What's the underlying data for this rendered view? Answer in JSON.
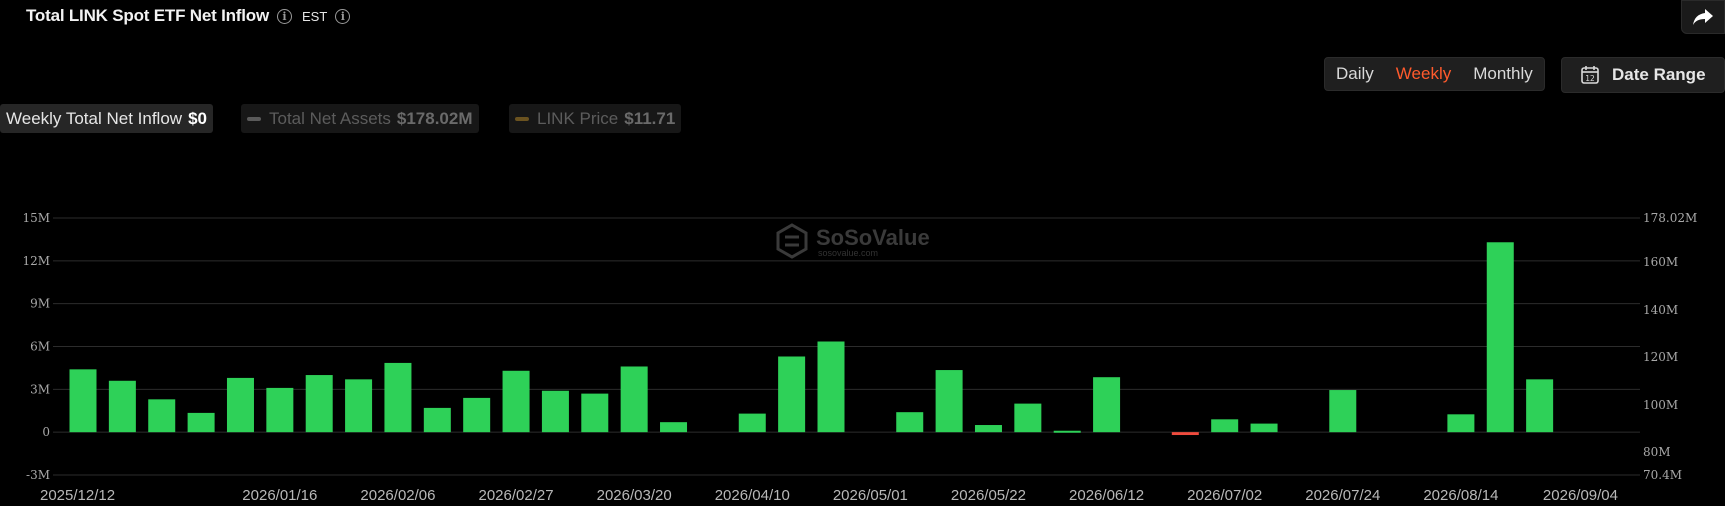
{
  "header": {
    "title": "Total LINK Spot ETF Net Inflow",
    "timezone": "EST"
  },
  "controls": {
    "periods": [
      "Daily",
      "Weekly",
      "Monthly"
    ],
    "active_period": "Weekly",
    "date_range_label": "Date Range",
    "date_range_icon_digit": "12"
  },
  "legend": {
    "net_inflow": {
      "label": "Weekly Total Net Inflow",
      "value": "$0"
    },
    "net_assets": {
      "label": "Total Net Assets",
      "value": "$178.02M"
    },
    "link_price": {
      "label": "LINK Price",
      "value": "$11.71"
    }
  },
  "watermark": {
    "brand": "SoSoValue",
    "sub": "sosovalue.com"
  },
  "colors": {
    "positive": "#2ed158",
    "negative": "#f04b3e",
    "active_tab": "#ff5a2c",
    "net_assets_line": "#5a5a5a",
    "price_line": "#6b5320"
  },
  "chart_data": {
    "type": "bar",
    "series": [
      {
        "name": "Weekly Total Net Inflow"
      }
    ],
    "x": [
      "2025/12/12",
      "2025/12/19",
      "2025/12/26",
      "2026/01/02",
      "2026/01/09",
      "2026/01/16",
      "2026/01/23",
      "2026/01/30",
      "2026/02/06",
      "2026/02/13",
      "2026/02/20",
      "2026/02/27",
      "2026/03/06",
      "2026/03/13",
      "2026/03/20",
      "2026/03/27",
      "2026/04/03",
      "2026/04/10",
      "2026/04/17",
      "2026/04/24",
      "2026/05/01",
      "2026/05/08",
      "2026/05/15",
      "2026/05/22",
      "2026/05/29",
      "2026/06/05",
      "2026/06/12",
      "2026/06/19",
      "2026/06/26",
      "2026/07/02",
      "2026/07/10",
      "2026/07/17",
      "2026/07/24",
      "2026/07/31",
      "2026/08/07",
      "2026/08/14",
      "2026/08/21",
      "2026/08/28",
      "2026/09/04"
    ],
    "values": [
      4.4,
      3.6,
      2.3,
      1.35,
      3.8,
      3.1,
      4.0,
      3.7,
      4.85,
      1.7,
      2.4,
      4.3,
      2.9,
      2.7,
      4.6,
      0.7,
      0,
      1.3,
      5.3,
      6.35,
      0,
      1.4,
      4.35,
      0.5,
      2.0,
      0.1,
      3.85,
      0,
      -0.2,
      0.9,
      0.6,
      0,
      2.95,
      0,
      0,
      1.25,
      13.3,
      3.7,
      0
    ],
    "x_tick_labels": [
      "2025/12/12",
      "2026/01/16",
      "2026/02/06",
      "2026/02/27",
      "2026/03/20",
      "2026/04/10",
      "2026/05/01",
      "2026/05/22",
      "2026/06/12",
      "2026/07/02",
      "2026/07/24",
      "2026/08/14",
      "2026/09/04"
    ],
    "y_left_ticks": [
      "-3M",
      "0",
      "3M",
      "6M",
      "9M",
      "12M",
      "15M"
    ],
    "y_left_range": [
      -3,
      15
    ],
    "y_right_ticks": [
      "70.4M",
      "80M",
      "100M",
      "120M",
      "140M",
      "160M",
      "178.02M"
    ],
    "unit": "M",
    "grid": true,
    "legend_position": "top-left"
  }
}
